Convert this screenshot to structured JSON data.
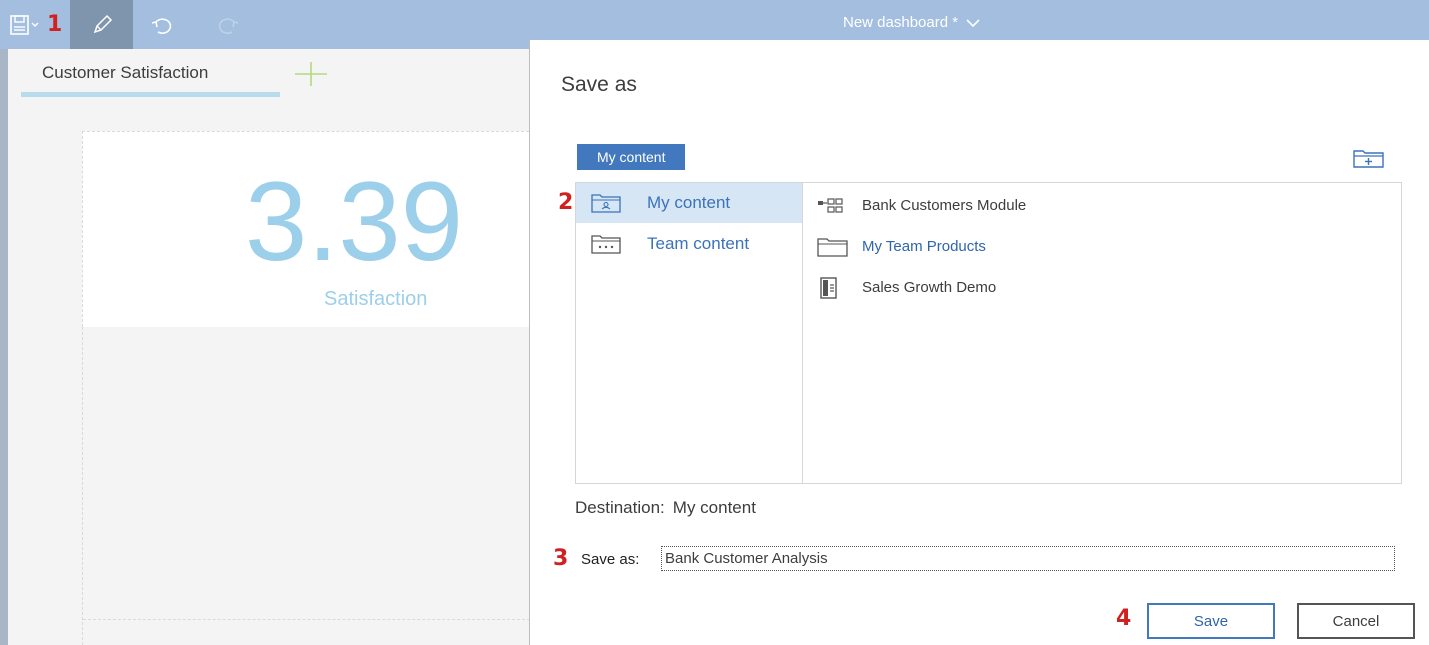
{
  "toolbar": {
    "save_icon": "save-icon",
    "edit_icon": "pencil-icon",
    "undo_icon": "undo-icon",
    "redo_icon": "redo-icon",
    "dashboard_title": "New dashboard *",
    "title_dropdown_icon": "chevron-down-icon"
  },
  "dashboard": {
    "tab_label": "Customer Satisfaction",
    "add_tab_icon": "plus-icon",
    "kpi_value": "3.39",
    "kpi_label": "Satisfaction"
  },
  "dialog": {
    "title": "Save as",
    "breadcrumb": "My content",
    "new_folder_icon": "new-folder-icon",
    "locations": [
      {
        "label": "My content",
        "icon": "user-folder-icon",
        "selected": true
      },
      {
        "label": "Team content",
        "icon": "team-folder-icon",
        "selected": false
      }
    ],
    "items": [
      {
        "label": "Bank Customers Module",
        "icon": "module-icon"
      },
      {
        "label": "My Team Products",
        "icon": "folder-icon"
      },
      {
        "label": "Sales Growth Demo",
        "icon": "report-icon"
      }
    ],
    "destination_label": "Destination:",
    "destination_value": "My content",
    "save_as_label": "Save as:",
    "save_as_value": "Bank Customer Analysis",
    "save_button": "Save",
    "cancel_button": "Cancel"
  },
  "annotations": [
    "1",
    "2",
    "3",
    "4"
  ],
  "colors": {
    "topbar": "#a3bedf",
    "accent": "#4178be",
    "selected_row": "#d6e6f4",
    "kpi": "#9ccfea",
    "annotation": "#d0201f"
  }
}
